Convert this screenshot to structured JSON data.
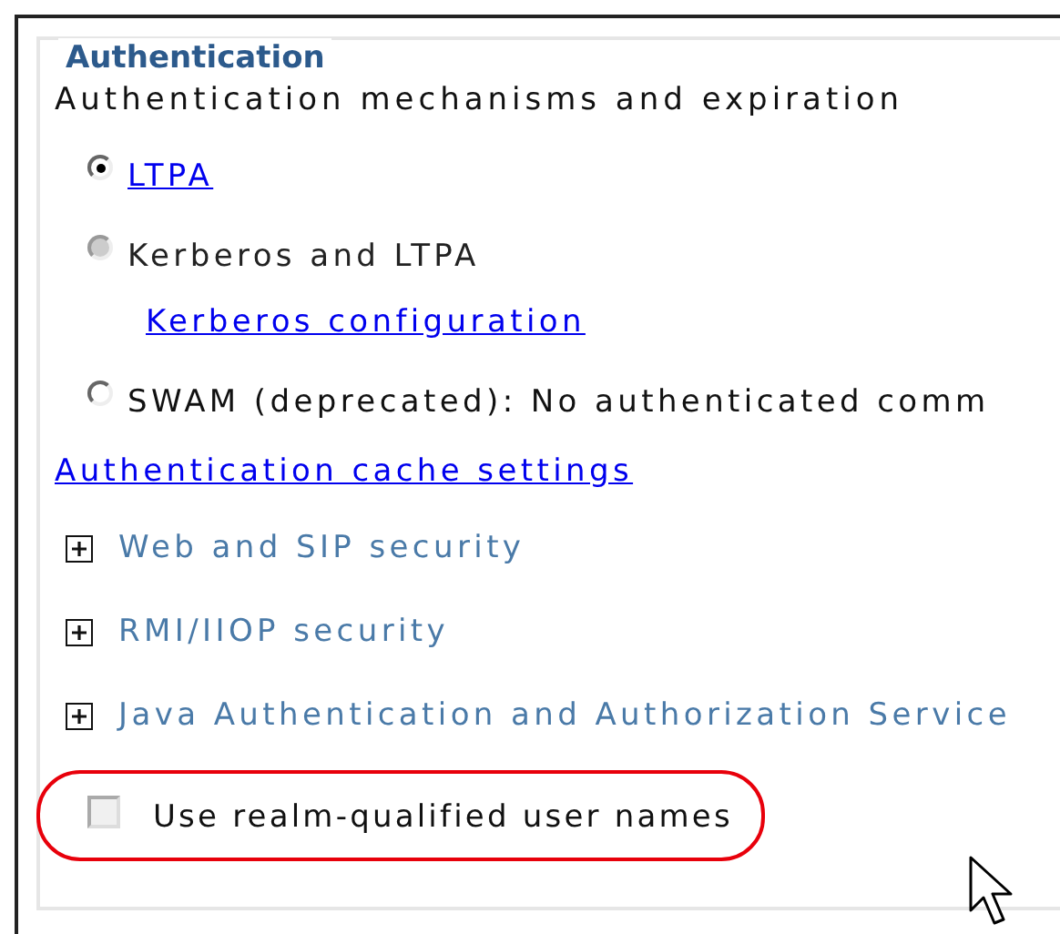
{
  "section": {
    "legend": "Authentication",
    "description": "Authentication mechanisms and expiration",
    "mechanisms": [
      {
        "label": "LTPA ",
        "kind": "link",
        "selected": true,
        "disabled": false
      },
      {
        "label": "Kerberos and LTPA",
        "kind": "text",
        "selected": false,
        "disabled": true,
        "sublink": "Kerberos configuration"
      },
      {
        "label": "SWAM (deprecated): No authenticated comm",
        "kind": "text",
        "selected": false,
        "disabled": false
      }
    ],
    "cache_link": "Authentication cache settings",
    "expanders": [
      {
        "label": "Web and SIP security",
        "expanded": false
      },
      {
        "label": "RMI/IIOP security",
        "expanded": false
      },
      {
        "label": "Java Authentication and Authorization Service",
        "expanded": false
      }
    ],
    "realm_option": {
      "label": "Use realm-qualified user names",
      "checked": false,
      "disabled": true,
      "highlighted": true
    }
  }
}
